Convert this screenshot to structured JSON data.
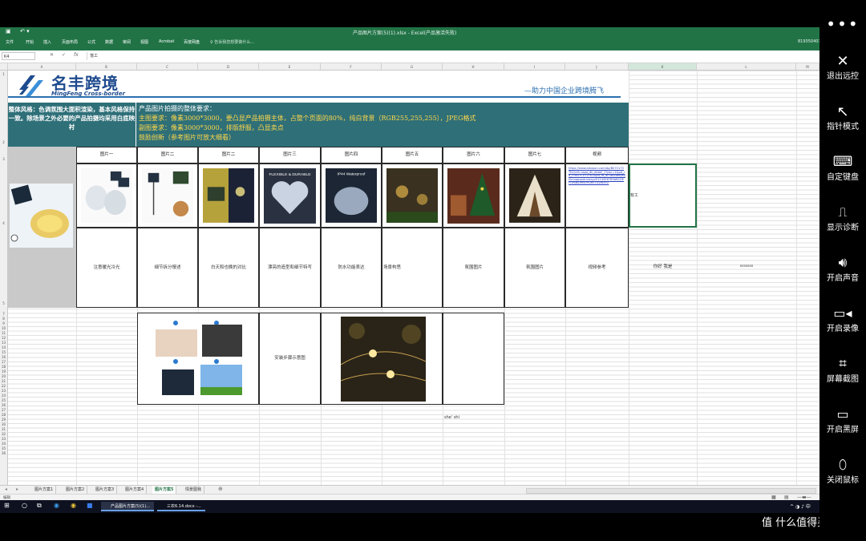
{
  "window": {
    "title": "产品图片方案(5)(1).xlsx - Excel(产品激活失败)",
    "account": "819350401"
  },
  "ribbon": {
    "menu": [
      "文件",
      "开始",
      "插入",
      "页面布局",
      "公式",
      "数据",
      "审阅",
      "视图",
      "Acrobat",
      "百度网盘"
    ],
    "tellme": "告诉我您想要做什么..."
  },
  "formula_bar": {
    "namebox": "K4",
    "value": "落工"
  },
  "columns": [
    "A",
    "B",
    "C",
    "D",
    "E",
    "F",
    "G",
    "H",
    "I",
    "J",
    "K",
    "L",
    "M"
  ],
  "rows": [
    "1",
    "2",
    "3",
    "4",
    "5",
    "6",
    "7",
    "8",
    "9",
    "10",
    "11",
    "12",
    "13",
    "14",
    "15",
    "16",
    "17",
    "18",
    "19",
    "20",
    "21",
    "22",
    "23",
    "24",
    "25",
    "26",
    "27",
    "28",
    "29",
    "30",
    "31",
    "32",
    "33",
    "34",
    "35",
    "36"
  ],
  "banner": {
    "logo_cn": "名丰跨境",
    "logo_en": "MingFeng Cross-border",
    "slogan": "—助力中国企业跨境腾飞"
  },
  "style_note": "整体风格：色调氛围大面积渲染，基本风格保持一致。除场景之外必要的产品拍摄均采用白底映衬",
  "photo_requirements": {
    "title": "产品图片拍摄的整体要求：",
    "main": "主图要求：像素3000*3000，要凸显产品拍摄主体，占整个页面的80%，纯白背景（RGB255,255,255），JPEG格式",
    "sub": "副图要求：像素3000*3000，排版舒服，凸显卖点",
    "encourage": "鼓励创新（参考图片可放大细看）"
  },
  "headers": [
    "图片一",
    "图片二",
    "图片二",
    "图片三",
    "图片四",
    "图片五",
    "图片六",
    "图片七",
    "视频"
  ],
  "descriptions": [
    "注意暖光冷光",
    "细节拆分慢述",
    "白天和也晚的对比",
    "漂亮的造型和细节特写",
    "防水功能表达",
    "场景构思",
    "氛围图片",
    "氛围图片",
    "视频参考",
    "你好    我是",
    "sssssss"
  ],
  "video_link": "https://www.amazon.com/dp/B07CV72TK2/ref=sspa_dk_detail_1?psc=1&pd_rd_i=B07CV72TK2&pd_rd_w=abcdefghijklmnopqrstuvwxyz0123456789ABCDEFGHIJKLMNOPQRSTUVWXYZ",
  "video_side_label": "有工",
  "install_label": "安装步骤示意图",
  "stray_text": "she' shi",
  "sheet_tabs": [
    "图片方案1",
    "图片方案2",
    "图片方案3",
    "图片方案4",
    "图片方案5",
    "情景图我"
  ],
  "active_tab": "图片方案5",
  "status": "编辑",
  "taskbar": {
    "app1": "产品图片方案(5)(1)...",
    "app2": "三农6.14.docx -..."
  },
  "side_menu": [
    "退出远控",
    "指针模式",
    "自定键盘",
    "显示诊断",
    "开启声音",
    "开启录像",
    "屏幕截图",
    "开启黑屏",
    "关闭鼠标"
  ],
  "watermark": "值 什么值得买",
  "colors": {
    "excel_green": "#217346",
    "teal": "#2e6f78",
    "highlight_text": "#ffd84a",
    "brand_blue": "#1e4b8e"
  }
}
